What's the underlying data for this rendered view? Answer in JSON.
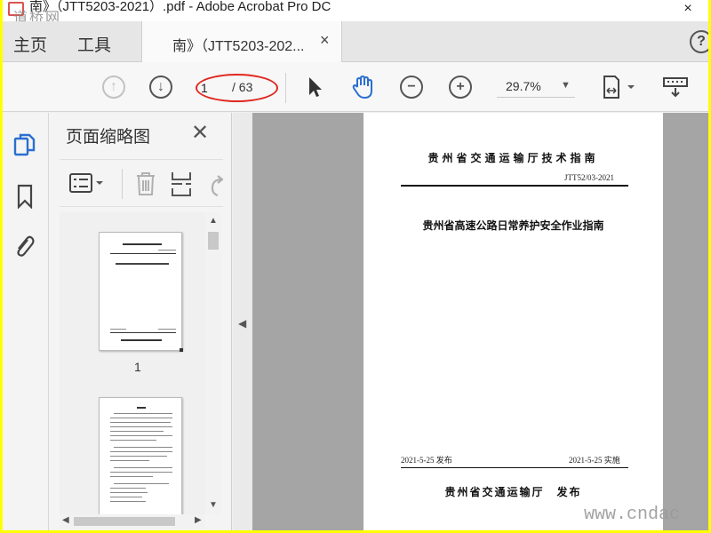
{
  "window": {
    "title": "南》（JTT5203-2021）.pdf - Adobe Acrobat Pro DC",
    "watermark_top": "道桥网",
    "close_glyph": "×"
  },
  "tabs": {
    "home": "主页",
    "tools": "工具",
    "document": "南》（JTT5203-202...",
    "close_glyph": "×",
    "help_glyph": "?"
  },
  "toolbar": {
    "current_page": "1",
    "total_pages": "/ 63",
    "zoom": "29.7%",
    "zoom_arrow": "▼"
  },
  "thumbnails_panel": {
    "title": "页面缩略图",
    "close_glyph": "✕",
    "page_label": "1",
    "scroll_up": "▲",
    "scroll_down": "▼",
    "scroll_left": "◀",
    "scroll_right": "▶"
  },
  "collapse_glyph": "◀",
  "document_page": {
    "header": "贵州省交通运输厅技术指南",
    "code": "JTT52/03-2021",
    "title": "贵州省高速公路日常养护安全作业指南",
    "issue_date": "2021-5-25 发布",
    "effective_date": "2021-5-25 实施",
    "issuer": "贵州省交通运输厅　发布"
  },
  "watermark_bottom": "www.cndac",
  "colors": {
    "highlight_oval": "#e0281f",
    "hand_tool": "#2a6fd0",
    "rail_active": "#2a6fd0",
    "outer_border": "#ffff00"
  }
}
